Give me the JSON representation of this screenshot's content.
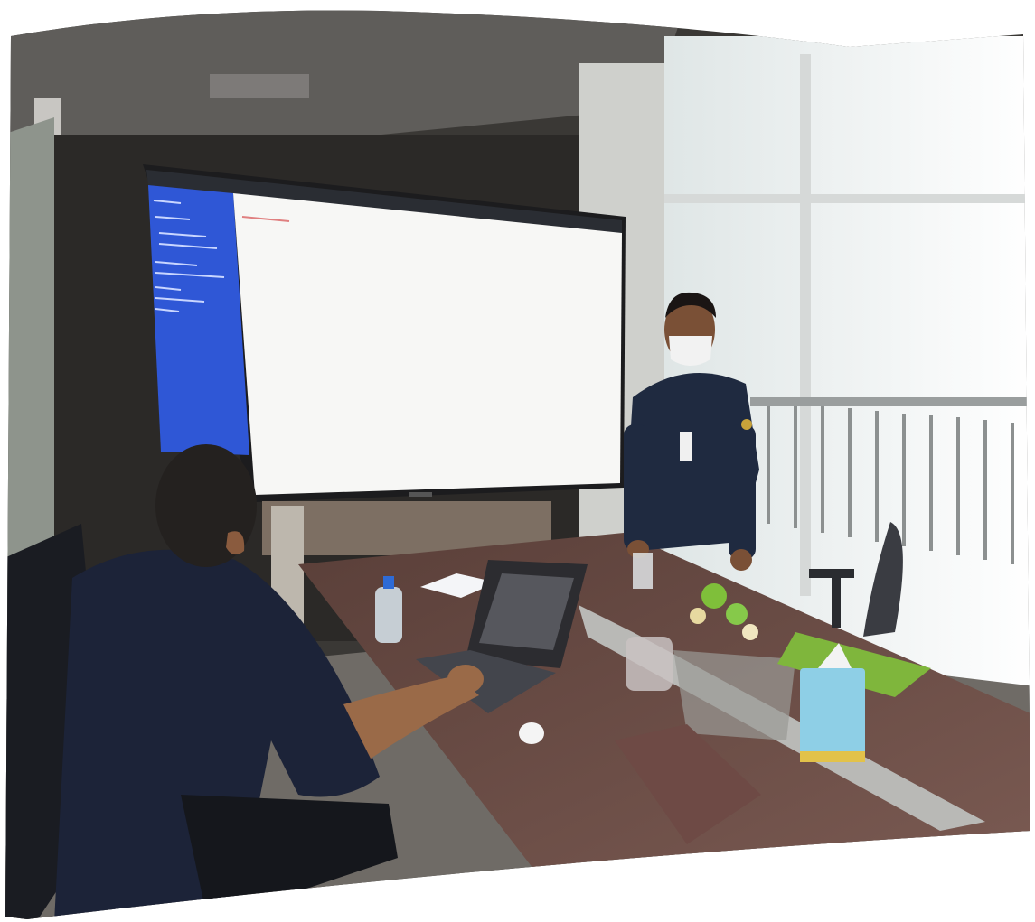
{
  "photo": {
    "subject": "meeting-room-presentation",
    "palette": {
      "page_bg": "#ffffff",
      "wall_dark": "#2e2c2a",
      "ceiling": "#6a6865",
      "window_light": "#eef1f1",
      "screen_sidebar": "#2f57d6",
      "screen_content": "#f7f7f5",
      "table_top": "#6b4c44",
      "shirt_navy": "#1f2a40",
      "mask_white": "#f2f2f2",
      "tissue_blue": "#8ecfe6",
      "pouch_brown": "#6e4a45",
      "chair_black": "#1a1c22"
    }
  }
}
